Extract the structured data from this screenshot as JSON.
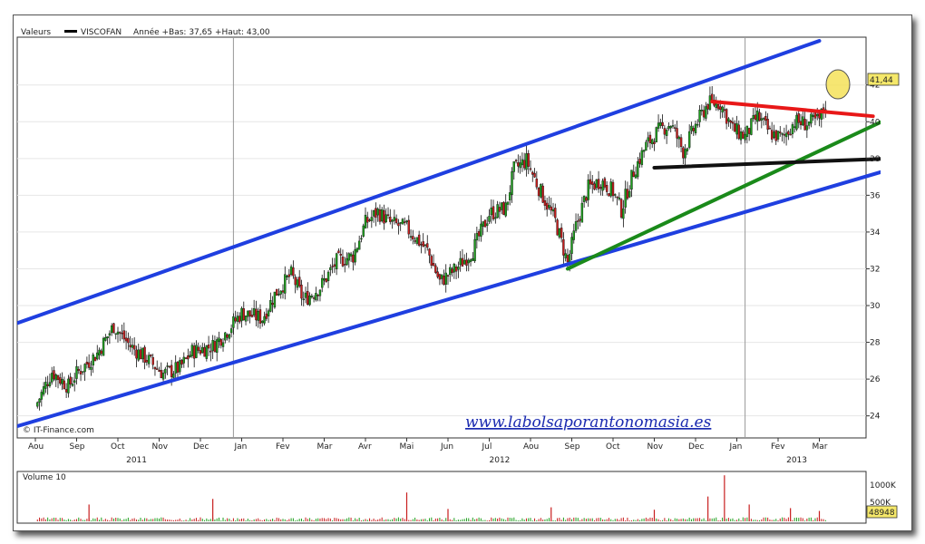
{
  "header": {
    "valeurs_label": "Valeurs",
    "instrument": "VISCOFAN",
    "range_text": "Année +Bas: 37,65 +Haut: 43,00"
  },
  "source_label": "© IT-Finance.com",
  "watermark": "www.labolsaporantonomasia.es",
  "last_price_label": "41,44",
  "volume": {
    "title": "Volume 10",
    "tick_labels": [
      "1000K",
      "500K"
    ],
    "last_value_label": "48948"
  },
  "chart_data": {
    "type": "candlestick",
    "title": "VISCOFAN",
    "price_axis": {
      "ylim": [
        22.8,
        44.6
      ],
      "ticks": [
        24,
        26,
        28,
        30,
        32,
        34,
        36,
        38,
        40,
        42
      ],
      "tick_labels": [
        "24",
        "26",
        "28",
        "30",
        "32",
        "34",
        "36",
        "38",
        "40",
        "42"
      ]
    },
    "x_months": [
      "Aou",
      "Sep",
      "Oct",
      "Nov",
      "Dec",
      "Jan",
      "Fev",
      "Mar",
      "Avr",
      "Mai",
      "Jun",
      "Jul",
      "Aou",
      "Sep",
      "Oct",
      "Nov",
      "Dec",
      "Jan",
      "Fev",
      "Mar"
    ],
    "x_years": [
      "2011",
      "2012",
      "2013"
    ],
    "last_price": 41.44,
    "price_path": [
      {
        "t": 0.0,
        "p": 24.5
      },
      {
        "t": 0.4,
        "p": 26.4
      },
      {
        "t": 0.8,
        "p": 25.6
      },
      {
        "t": 1.0,
        "p": 26.3
      },
      {
        "t": 1.5,
        "p": 27.4
      },
      {
        "t": 1.9,
        "p": 28.9
      },
      {
        "t": 2.3,
        "p": 27.8
      },
      {
        "t": 2.7,
        "p": 27.1
      },
      {
        "t": 3.1,
        "p": 26.3
      },
      {
        "t": 3.5,
        "p": 26.6
      },
      {
        "t": 3.8,
        "p": 27.5
      },
      {
        "t": 4.3,
        "p": 27.8
      },
      {
        "t": 4.6,
        "p": 28.5
      },
      {
        "t": 5.0,
        "p": 29.6
      },
      {
        "t": 5.5,
        "p": 29.3
      },
      {
        "t": 5.8,
        "p": 30.6
      },
      {
        "t": 6.2,
        "p": 31.7
      },
      {
        "t": 6.5,
        "p": 30.3
      },
      {
        "t": 6.9,
        "p": 31.0
      },
      {
        "t": 7.3,
        "p": 32.4
      },
      {
        "t": 7.7,
        "p": 32.7
      },
      {
        "t": 8.0,
        "p": 34.5
      },
      {
        "t": 8.3,
        "p": 35.1
      },
      {
        "t": 8.6,
        "p": 34.5
      },
      {
        "t": 9.0,
        "p": 34.2
      },
      {
        "t": 9.5,
        "p": 33.0
      },
      {
        "t": 9.8,
        "p": 31.3
      },
      {
        "t": 10.2,
        "p": 32.0
      },
      {
        "t": 10.6,
        "p": 33.0
      },
      {
        "t": 11.0,
        "p": 35.0
      },
      {
        "t": 11.4,
        "p": 35.3
      },
      {
        "t": 11.6,
        "p": 37.4
      },
      {
        "t": 11.9,
        "p": 37.9
      },
      {
        "t": 12.2,
        "p": 36.4
      },
      {
        "t": 12.6,
        "p": 34.6
      },
      {
        "t": 12.9,
        "p": 32.3
      },
      {
        "t": 13.1,
        "p": 34.3
      },
      {
        "t": 13.4,
        "p": 36.4
      },
      {
        "t": 13.7,
        "p": 36.8
      },
      {
        "t": 14.0,
        "p": 36.2
      },
      {
        "t": 14.2,
        "p": 35.2
      },
      {
        "t": 14.5,
        "p": 37.3
      },
      {
        "t": 14.8,
        "p": 38.7
      },
      {
        "t": 15.1,
        "p": 39.5
      },
      {
        "t": 15.4,
        "p": 39.9
      },
      {
        "t": 15.7,
        "p": 38.4
      },
      {
        "t": 16.0,
        "p": 39.8
      },
      {
        "t": 16.3,
        "p": 41.0
      },
      {
        "t": 16.6,
        "p": 41.0
      },
      {
        "t": 16.9,
        "p": 39.6
      },
      {
        "t": 17.2,
        "p": 39.2
      },
      {
        "t": 17.5,
        "p": 40.3
      },
      {
        "t": 17.8,
        "p": 39.4
      },
      {
        "t": 18.1,
        "p": 39.1
      },
      {
        "t": 18.4,
        "p": 40.0
      },
      {
        "t": 18.7,
        "p": 39.9
      },
      {
        "t": 19.0,
        "p": 40.1
      },
      {
        "t": 19.2,
        "p": 41.2
      }
    ],
    "trendlines": [
      {
        "name": "channel-upper",
        "color": "#1f3fe0",
        "from": {
          "t": -0.5,
          "p": 29.0
        },
        "to": {
          "t": 19.0,
          "p": 44.4
        }
      },
      {
        "name": "channel-lower",
        "color": "#1f3fe0",
        "from": {
          "t": -0.5,
          "p": 23.4
        },
        "to": {
          "t": 20.7,
          "p": 37.4
        }
      },
      {
        "name": "support-green",
        "color": "#1a8a1a",
        "from": {
          "t": 12.9,
          "p": 32.0
        },
        "to": {
          "t": 20.7,
          "p": 40.2
        }
      },
      {
        "name": "support-black",
        "color": "#111111",
        "from": {
          "t": 15.0,
          "p": 37.5
        },
        "to": {
          "t": 20.7,
          "p": 38.0
        }
      },
      {
        "name": "resistance-red",
        "color": "#e81818",
        "from": {
          "t": 16.4,
          "p": 41.1
        },
        "to": {
          "t": 20.3,
          "p": 40.3
        }
      }
    ],
    "volume_series": {
      "scale_max_k": 1200,
      "spikes": [
        {
          "t": 1.3,
          "k": 420
        },
        {
          "t": 4.3,
          "k": 560
        },
        {
          "t": 9.0,
          "k": 720
        },
        {
          "t": 10.0,
          "k": 310
        },
        {
          "t": 12.5,
          "k": 350
        },
        {
          "t": 15.0,
          "k": 290
        },
        {
          "t": 16.3,
          "k": 620
        },
        {
          "t": 16.7,
          "k": 1150
        },
        {
          "t": 17.3,
          "k": 420
        },
        {
          "t": 18.3,
          "k": 330
        },
        {
          "t": 19.0,
          "k": 260
        }
      ]
    }
  }
}
